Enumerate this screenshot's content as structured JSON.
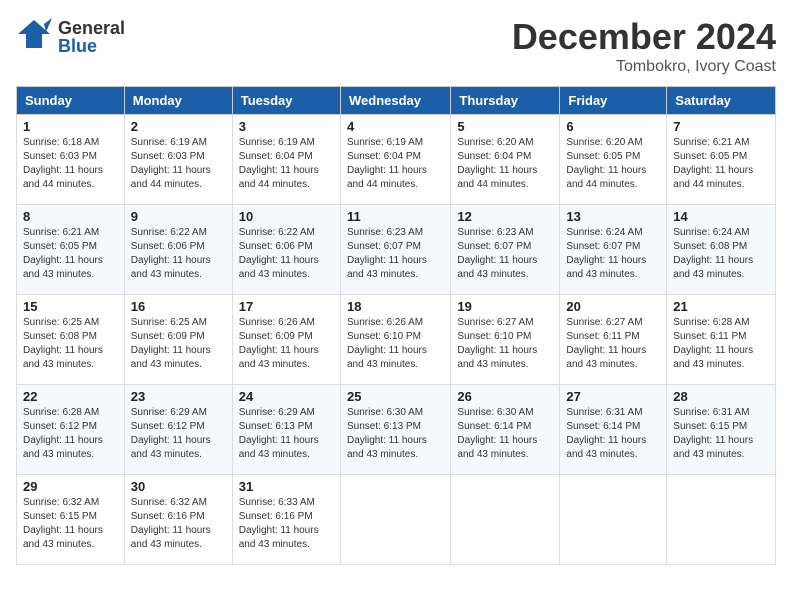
{
  "header": {
    "logo_general": "General",
    "logo_blue": "Blue",
    "month_title": "December 2024",
    "location": "Tombokro, Ivory Coast"
  },
  "days_of_week": [
    "Sunday",
    "Monday",
    "Tuesday",
    "Wednesday",
    "Thursday",
    "Friday",
    "Saturday"
  ],
  "weeks": [
    [
      {
        "day": "1",
        "sunrise": "Sunrise: 6:18 AM",
        "sunset": "Sunset: 6:03 PM",
        "daylight": "Daylight: 11 hours and 44 minutes."
      },
      {
        "day": "2",
        "sunrise": "Sunrise: 6:19 AM",
        "sunset": "Sunset: 6:03 PM",
        "daylight": "Daylight: 11 hours and 44 minutes."
      },
      {
        "day": "3",
        "sunrise": "Sunrise: 6:19 AM",
        "sunset": "Sunset: 6:04 PM",
        "daylight": "Daylight: 11 hours and 44 minutes."
      },
      {
        "day": "4",
        "sunrise": "Sunrise: 6:19 AM",
        "sunset": "Sunset: 6:04 PM",
        "daylight": "Daylight: 11 hours and 44 minutes."
      },
      {
        "day": "5",
        "sunrise": "Sunrise: 6:20 AM",
        "sunset": "Sunset: 6:04 PM",
        "daylight": "Daylight: 11 hours and 44 minutes."
      },
      {
        "day": "6",
        "sunrise": "Sunrise: 6:20 AM",
        "sunset": "Sunset: 6:05 PM",
        "daylight": "Daylight: 11 hours and 44 minutes."
      },
      {
        "day": "7",
        "sunrise": "Sunrise: 6:21 AM",
        "sunset": "Sunset: 6:05 PM",
        "daylight": "Daylight: 11 hours and 44 minutes."
      }
    ],
    [
      {
        "day": "8",
        "sunrise": "Sunrise: 6:21 AM",
        "sunset": "Sunset: 6:05 PM",
        "daylight": "Daylight: 11 hours and 43 minutes."
      },
      {
        "day": "9",
        "sunrise": "Sunrise: 6:22 AM",
        "sunset": "Sunset: 6:06 PM",
        "daylight": "Daylight: 11 hours and 43 minutes."
      },
      {
        "day": "10",
        "sunrise": "Sunrise: 6:22 AM",
        "sunset": "Sunset: 6:06 PM",
        "daylight": "Daylight: 11 hours and 43 minutes."
      },
      {
        "day": "11",
        "sunrise": "Sunrise: 6:23 AM",
        "sunset": "Sunset: 6:07 PM",
        "daylight": "Daylight: 11 hours and 43 minutes."
      },
      {
        "day": "12",
        "sunrise": "Sunrise: 6:23 AM",
        "sunset": "Sunset: 6:07 PM",
        "daylight": "Daylight: 11 hours and 43 minutes."
      },
      {
        "day": "13",
        "sunrise": "Sunrise: 6:24 AM",
        "sunset": "Sunset: 6:07 PM",
        "daylight": "Daylight: 11 hours and 43 minutes."
      },
      {
        "day": "14",
        "sunrise": "Sunrise: 6:24 AM",
        "sunset": "Sunset: 6:08 PM",
        "daylight": "Daylight: 11 hours and 43 minutes."
      }
    ],
    [
      {
        "day": "15",
        "sunrise": "Sunrise: 6:25 AM",
        "sunset": "Sunset: 6:08 PM",
        "daylight": "Daylight: 11 hours and 43 minutes."
      },
      {
        "day": "16",
        "sunrise": "Sunrise: 6:25 AM",
        "sunset": "Sunset: 6:09 PM",
        "daylight": "Daylight: 11 hours and 43 minutes."
      },
      {
        "day": "17",
        "sunrise": "Sunrise: 6:26 AM",
        "sunset": "Sunset: 6:09 PM",
        "daylight": "Daylight: 11 hours and 43 minutes."
      },
      {
        "day": "18",
        "sunrise": "Sunrise: 6:26 AM",
        "sunset": "Sunset: 6:10 PM",
        "daylight": "Daylight: 11 hours and 43 minutes."
      },
      {
        "day": "19",
        "sunrise": "Sunrise: 6:27 AM",
        "sunset": "Sunset: 6:10 PM",
        "daylight": "Daylight: 11 hours and 43 minutes."
      },
      {
        "day": "20",
        "sunrise": "Sunrise: 6:27 AM",
        "sunset": "Sunset: 6:11 PM",
        "daylight": "Daylight: 11 hours and 43 minutes."
      },
      {
        "day": "21",
        "sunrise": "Sunrise: 6:28 AM",
        "sunset": "Sunset: 6:11 PM",
        "daylight": "Daylight: 11 hours and 43 minutes."
      }
    ],
    [
      {
        "day": "22",
        "sunrise": "Sunrise: 6:28 AM",
        "sunset": "Sunset: 6:12 PM",
        "daylight": "Daylight: 11 hours and 43 minutes."
      },
      {
        "day": "23",
        "sunrise": "Sunrise: 6:29 AM",
        "sunset": "Sunset: 6:12 PM",
        "daylight": "Daylight: 11 hours and 43 minutes."
      },
      {
        "day": "24",
        "sunrise": "Sunrise: 6:29 AM",
        "sunset": "Sunset: 6:13 PM",
        "daylight": "Daylight: 11 hours and 43 minutes."
      },
      {
        "day": "25",
        "sunrise": "Sunrise: 6:30 AM",
        "sunset": "Sunset: 6:13 PM",
        "daylight": "Daylight: 11 hours and 43 minutes."
      },
      {
        "day": "26",
        "sunrise": "Sunrise: 6:30 AM",
        "sunset": "Sunset: 6:14 PM",
        "daylight": "Daylight: 11 hours and 43 minutes."
      },
      {
        "day": "27",
        "sunrise": "Sunrise: 6:31 AM",
        "sunset": "Sunset: 6:14 PM",
        "daylight": "Daylight: 11 hours and 43 minutes."
      },
      {
        "day": "28",
        "sunrise": "Sunrise: 6:31 AM",
        "sunset": "Sunset: 6:15 PM",
        "daylight": "Daylight: 11 hours and 43 minutes."
      }
    ],
    [
      {
        "day": "29",
        "sunrise": "Sunrise: 6:32 AM",
        "sunset": "Sunset: 6:15 PM",
        "daylight": "Daylight: 11 hours and 43 minutes."
      },
      {
        "day": "30",
        "sunrise": "Sunrise: 6:32 AM",
        "sunset": "Sunset: 6:16 PM",
        "daylight": "Daylight: 11 hours and 43 minutes."
      },
      {
        "day": "31",
        "sunrise": "Sunrise: 6:33 AM",
        "sunset": "Sunset: 6:16 PM",
        "daylight": "Daylight: 11 hours and 43 minutes."
      },
      null,
      null,
      null,
      null
    ]
  ]
}
